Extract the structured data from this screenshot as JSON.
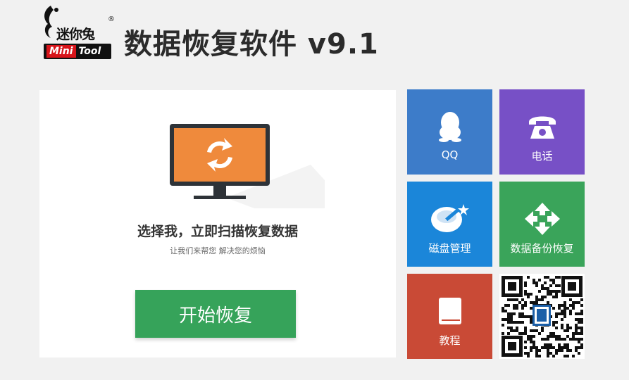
{
  "header": {
    "logo_cn": "迷你兔",
    "logo_reg": "®",
    "logo_mini": "Mini",
    "logo_tool": "Tool",
    "title": "数据恢复软件 v9.1"
  },
  "main": {
    "heading": "选择我，立即扫描恢复数据",
    "subheading": "让我们来帮您  解决您的烦恼",
    "start_button": "开始恢复"
  },
  "tiles": {
    "qq": "QQ",
    "phone": "电话",
    "disk": "磁盘管理",
    "backup": "数据备份恢复",
    "tutorial": "教程"
  },
  "colors": {
    "qq": "#3d7cc9",
    "phone": "#7750c6",
    "disk": "#1b86d9",
    "backup": "#3aa45a",
    "tutorial": "#c94a36",
    "start": "#36a35a",
    "monitor_screen": "#ef8a3c"
  }
}
